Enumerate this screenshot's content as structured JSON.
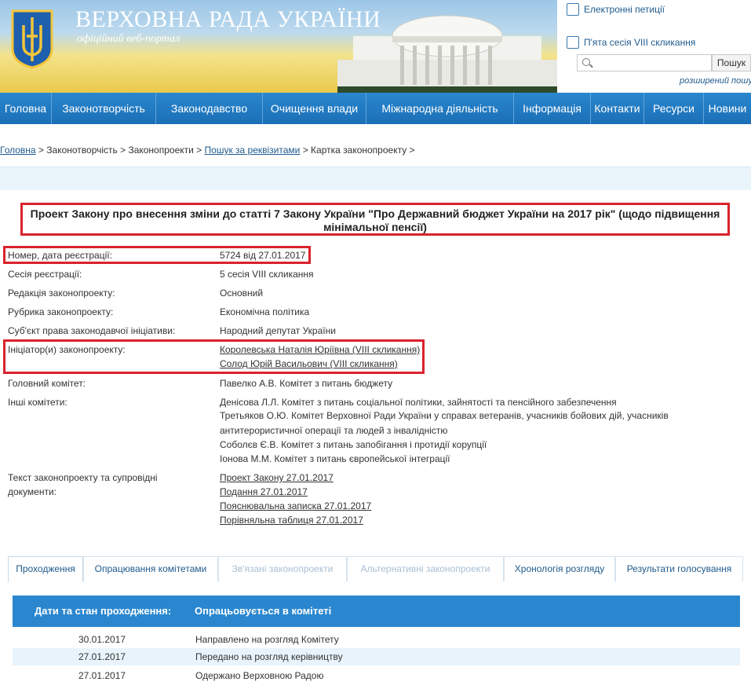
{
  "header": {
    "title": "ВЕРХОВНА РАДА УКРАЇНИ",
    "subtitle": "офіційний веб-портал",
    "petitions_link": "Електронні петиції",
    "session_link": "П'ята сесія VIII скликання",
    "search_placeholder": "",
    "search_button": "Пошук",
    "advanced_search": "розширений пошук"
  },
  "nav": {
    "items": [
      "Головна",
      "Законотворчість",
      "Законодавство",
      "Очищення влади",
      "Міжнародна діяльність",
      "Інформація",
      "Контакти",
      "Ресурси",
      "Новини"
    ]
  },
  "breadcrumb": {
    "home": "Головна",
    "sep1": " > Законотворчість > Законопроекти > ",
    "search": "Пошук за реквізитами",
    "sep2": " > Картка законопроекту >"
  },
  "bill": {
    "title": "Проект Закону про внесення зміни до статті 7 Закону України \"Про Державний бюджет України на 2017 рік\" (щодо підвищення мінімальної пенсії)",
    "fields": {
      "number_label": "Номер, дата реєстрації:",
      "number_value": "5724 від 27.01.2017",
      "session_label": "Сесія реєстрації:",
      "session_value": "5 сесія VIII скликання",
      "edition_label": "Редакція законопроекту:",
      "edition_value": "Основний",
      "rubric_label": "Рубрика законопроекту:",
      "rubric_value": "Економічна політика",
      "subject_label": "Суб'єкт права законодавчої ініціативи:",
      "subject_value": "Народний депутат України",
      "initiators_label": "Ініціатор(и) законопроекту:",
      "initiator_1": "Королевська Наталія Юріївна (VIII скликання)",
      "initiator_2": "Солод Юрій Васильович (VIII скликання)",
      "main_committee_label": "Головний комітет:",
      "main_committee_value": "Павелко А.В. Комітет з питань бюджету",
      "other_committees_label": "Інші комітети:",
      "other_committees": [
        "Денісова Л.Л. Комітет з питань соціальної політики, зайнятості та пенсійного забезпечення",
        "Третьяков О.Ю. Комітет Верховної Ради України у справах ветеранів, учасників бойових дій, учасників",
        "антитерористичної операції та людей з інвалідністю",
        "Соболєв Є.В. Комітет з питань запобігання і протидії корупції",
        "Іонова М.М. Комітет з питань європейської інтеграції"
      ],
      "docs_label_1": "Текст законопроекту та супровідні",
      "docs_label_2": "документи:",
      "docs": [
        "Проект Закону 27.01.2017",
        "Подання 27.01.2017",
        "Пояснювальна записка 27.01.2017",
        "Порівняльна таблиця 27.01.2017"
      ]
    }
  },
  "tabs": [
    "Проходження",
    "Опрацювання комітетами",
    "Зв'язані законопроекти",
    "Альтернативні законопроекти",
    "Хронологія розгляду",
    "Результати голосування"
  ],
  "passage": {
    "col_dates": "Дати та стан проходження:",
    "col_status": "Опрацьовується в комітеті",
    "rows": [
      {
        "date": "30.01.2017",
        "event": "Направлено на розгляд Комітету"
      },
      {
        "date": "27.01.2017",
        "event": "Передано на розгляд керівництву"
      },
      {
        "date": "27.01.2017",
        "event": "Одержано Верховною Радою"
      }
    ]
  },
  "colors": {
    "nav_blue": "#1b6fb5",
    "link_blue": "#1f5a8c",
    "highlight_red": "#d9232d"
  }
}
